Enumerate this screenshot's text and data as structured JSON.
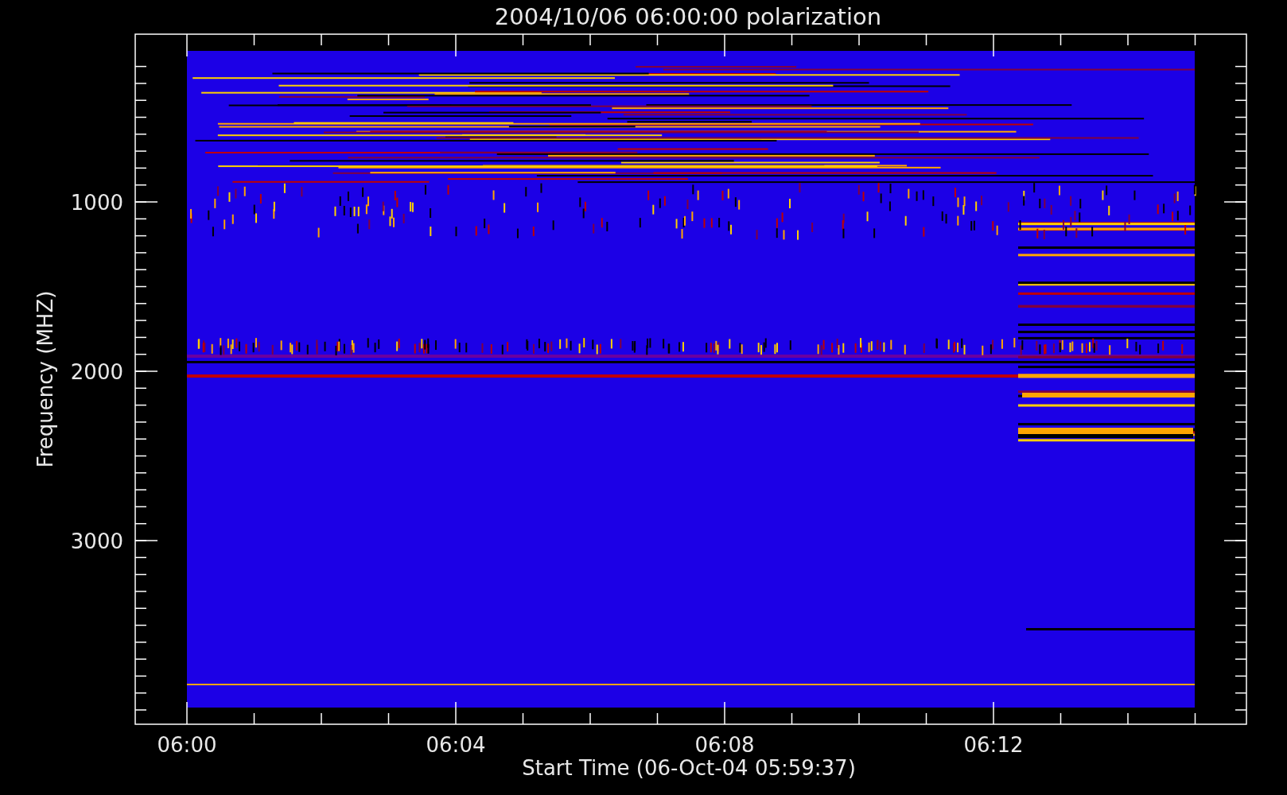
{
  "title": "2004/10/06 06:00:00 polarization",
  "ylabel": "Frequency (MHZ)",
  "yticks": [
    "1000",
    "2000",
    "3000"
  ],
  "xlabel": "Start Time (06-Oct-04 05:59:37)",
  "xticks": [
    "06:00",
    "06:04",
    "06:08",
    "06:12"
  ]
}
